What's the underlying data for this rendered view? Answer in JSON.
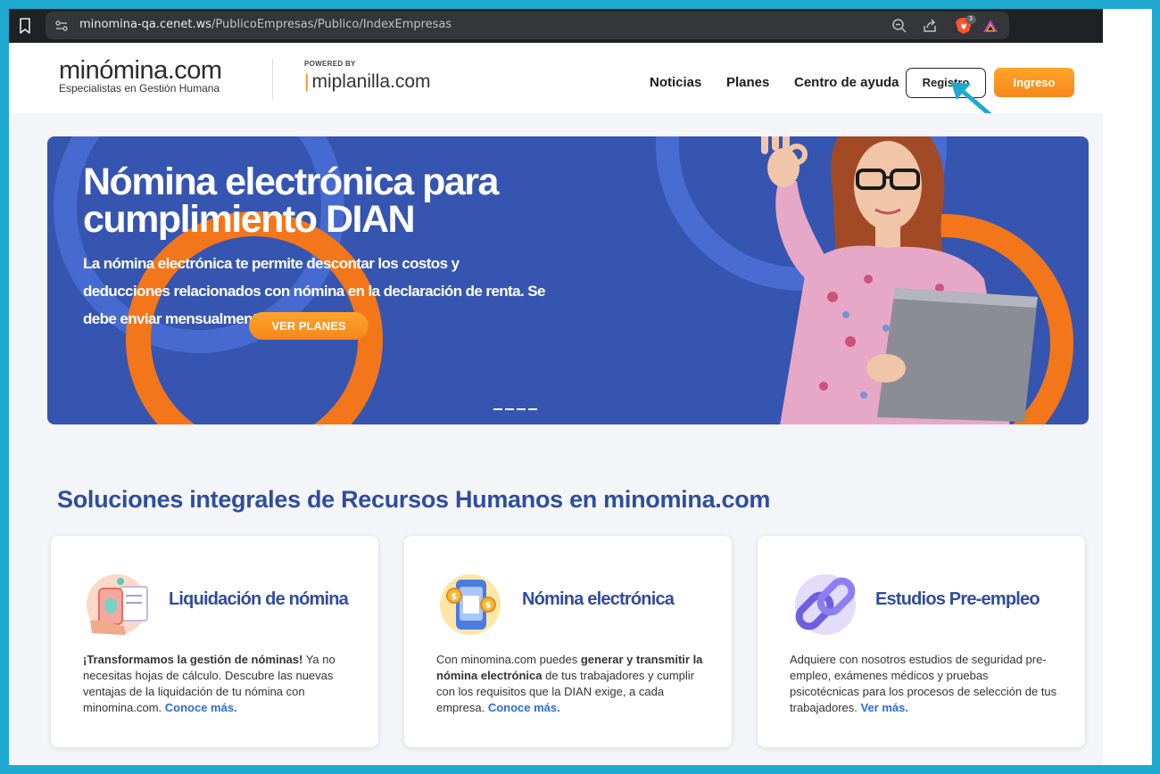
{
  "browser": {
    "url_host": "minomina-qa.cenet.ws",
    "url_path": "/PublicoEmpresas/Publico/IndexEmpresas",
    "brave_badge_count": "3"
  },
  "header": {
    "logo_text": "minómina.com",
    "logo_tagline": "Especialistas en Gestión Humana",
    "powered_by": "POWERED BY",
    "partner_logo": "miplanilla.com",
    "nav": [
      "Noticias",
      "Planes",
      "Centro de ayuda"
    ],
    "register_label": "Registro",
    "login_label": "Ingreso"
  },
  "hero": {
    "title": "Nómina electrónica para cumplimiento DIAN",
    "text": "La nómina electrónica te permite descontar los costos y deducciones relacionados con nómina en la declaración de renta. Se debe enviar mensualmente a la DIAN.",
    "cta": "VER PLANES",
    "slide_count": 4
  },
  "section": {
    "title": "Soluciones integrales de Recursos Humanos en minomina.com"
  },
  "cards": [
    {
      "icon": "payroll-hand-icon",
      "title": "Liquidación de nómina",
      "bold": "¡Transformamos la gestión de nóminas!",
      "text": " Ya no necesitas hojas de cálculo. Descubre las nuevas ventajas de la liquidación de tu nómina con minomina.com. ",
      "link": "Conoce más."
    },
    {
      "icon": "phone-coins-icon",
      "title": "Nómina electrónica",
      "pre": "Con minomina.com puedes ",
      "bold": "generar y transmitir la nómina electrónica",
      "text": " de tus trabajadores y cumplir con los requisitos que la DIAN exige, a cada empresa. ",
      "link": "Conoce más."
    },
    {
      "icon": "chain-link-icon",
      "title": "Estudios Pre-empleo",
      "text": "Adquiere con nosotros estudios de seguridad pre-empleo, exámenes médicos y pruebas psicotécnicas para los procesos de selección de tus trabajadores. ",
      "link": "Ver más."
    }
  ],
  "colors": {
    "frame_border": "#1eaad0",
    "banner_blue": "#3555b0",
    "accent_orange": "#f6871a",
    "heading_blue": "#2f4d9e",
    "link_blue": "#2f6ad9"
  }
}
